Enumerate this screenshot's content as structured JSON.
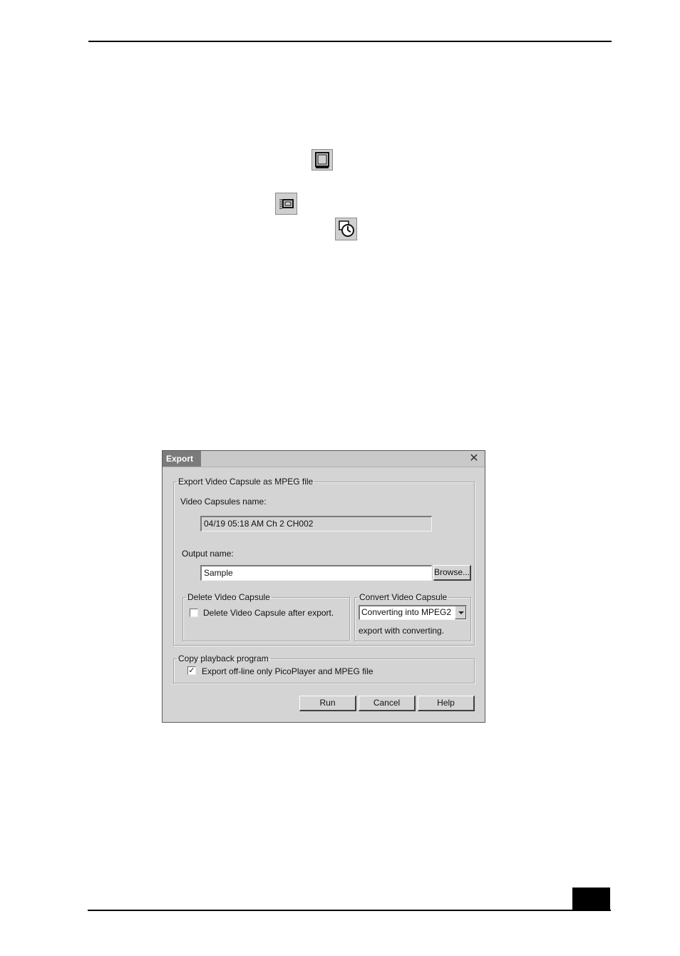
{
  "dialog": {
    "title": "Export",
    "close_glyph": "✕",
    "export_group": {
      "legend": "Export Video Capsule as MPEG file",
      "capsules_label": "Video Capsules name:",
      "capsules_value": "04/19 05:18 AM Ch 2 CH002",
      "output_label": "Output name:",
      "output_value": "Sample",
      "browse_label": "Browse..."
    },
    "delete_group": {
      "legend": "Delete Video Capsule",
      "checkbox_label": "Delete Video Capsule after export.",
      "checked": false
    },
    "convert_group": {
      "legend": "Convert Video Capsule",
      "selected": "Converting into MPEG2",
      "note": "export with converting."
    },
    "copy_group": {
      "legend": "Copy playback program",
      "checkbox_label": "Export off-line only PicoPlayer and MPEG file",
      "checked": true,
      "check_glyph": "✓"
    },
    "buttons": {
      "run": "Run",
      "cancel": "Cancel",
      "help": "Help"
    }
  },
  "icons": [
    "window-icon",
    "video-capsule-icon",
    "timer-icon"
  ]
}
